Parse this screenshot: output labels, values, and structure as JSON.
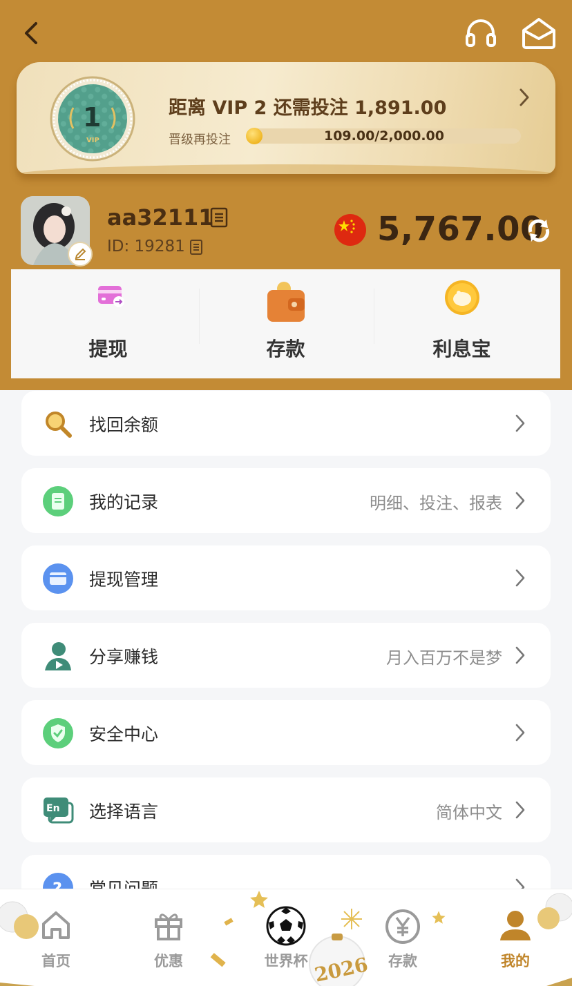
{
  "header": {
    "back_icon": "chevron-left-icon",
    "support_icon": "headset-icon",
    "mail_icon": "envelope-icon"
  },
  "vip": {
    "level": "1",
    "badge_text": "VIP",
    "title": "距离 VIP 2 还需投注 1,891.00",
    "progress_label": "晋级再投注",
    "progress_text": "109.00/2,000.00",
    "progress_fraction": 0.0545
  },
  "user": {
    "name": "aa32111",
    "id": "ID: 19281",
    "balance": "5,767.00",
    "flag": "china-flag-icon"
  },
  "actions": [
    {
      "label": "提现",
      "icon": "withdraw-card-icon"
    },
    {
      "label": "存款",
      "icon": "wallet-icon"
    },
    {
      "label": "利息宝",
      "icon": "piggy-bank-icon"
    }
  ],
  "menu": [
    {
      "label": "找回余额",
      "value": "",
      "icon": "search-icon"
    },
    {
      "label": "我的记录",
      "value": "明细、投注、报表",
      "icon": "record-icon"
    },
    {
      "label": "提现管理",
      "value": "",
      "icon": "card-icon"
    },
    {
      "label": "分享赚钱",
      "value": "月入百万不是梦",
      "icon": "share-user-icon"
    },
    {
      "label": "安全中心",
      "value": "",
      "icon": "shield-icon"
    },
    {
      "label": "选择语言",
      "value": "简体中文",
      "icon": "language-icon"
    },
    {
      "label": "常见问题",
      "value": "",
      "icon": "question-icon"
    }
  ],
  "tabs": [
    {
      "label": "首页",
      "icon": "home-icon"
    },
    {
      "label": "优惠",
      "icon": "gift-icon"
    },
    {
      "label": "世界杯",
      "icon": "soccer-ball-icon"
    },
    {
      "label": "存款",
      "icon": "yen-icon"
    },
    {
      "label": "我的",
      "icon": "user-icon"
    }
  ],
  "tabbar_badge": "2026",
  "colors": {
    "header_bg": "#c38b35",
    "accent": "#c0852a",
    "page_bg": "#f5f6f8"
  }
}
